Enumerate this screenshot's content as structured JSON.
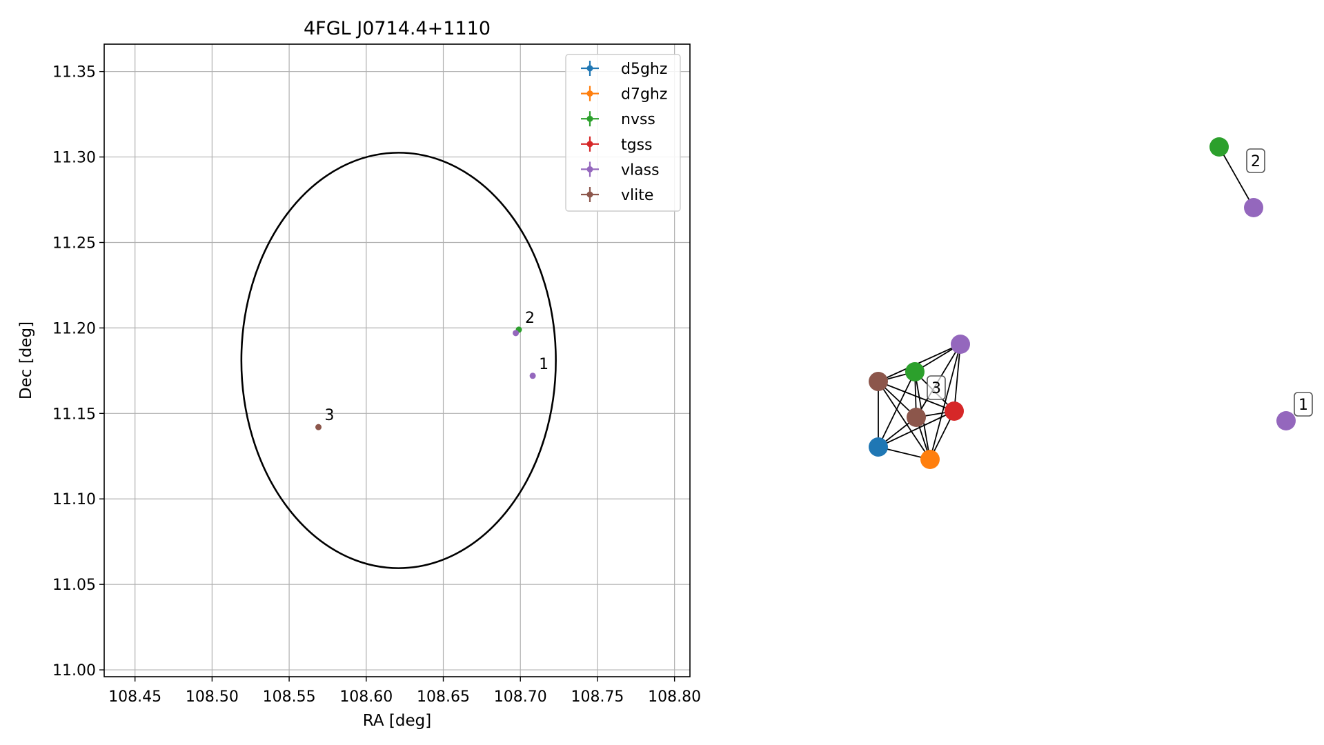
{
  "chart_data": [
    {
      "type": "scatter",
      "title": "4FGL J0714.4+1110",
      "xlabel": "RA [deg]",
      "ylabel": "Dec [deg]",
      "xlim": [
        108.43,
        108.81
      ],
      "ylim": [
        10.996,
        11.366
      ],
      "x_ticks": [
        108.45,
        108.5,
        108.55,
        108.6,
        108.65,
        108.7,
        108.75,
        108.8
      ],
      "x_tick_labels": [
        "108.45",
        "108.50",
        "108.55",
        "108.60",
        "108.65",
        "108.70",
        "108.75",
        "108.80"
      ],
      "y_ticks": [
        11.0,
        11.05,
        11.1,
        11.15,
        11.2,
        11.25,
        11.3,
        11.35
      ],
      "y_tick_labels": [
        "11.00",
        "11.05",
        "11.10",
        "11.15",
        "11.20",
        "11.25",
        "11.30",
        "11.35"
      ],
      "grid": true,
      "legend_position": "top-right",
      "ellipse": {
        "center": [
          108.621,
          11.181
        ],
        "semi_axis_ra": 0.102,
        "semi_axis_dec": 0.1215,
        "color": "#000000"
      },
      "series": [
        {
          "name": "d5ghz",
          "color": "#1f77b4",
          "points": []
        },
        {
          "name": "d7ghz",
          "color": "#ff7f0e",
          "points": []
        },
        {
          "name": "nvss",
          "color": "#2ca02c",
          "points": [
            {
              "x": 108.699,
              "y": 11.199
            }
          ]
        },
        {
          "name": "tgss",
          "color": "#d62728",
          "points": []
        },
        {
          "name": "vlass",
          "color": "#9467bd",
          "points": [
            {
              "x": 108.697,
              "y": 11.197
            },
            {
              "x": 108.708,
              "y": 11.172
            }
          ]
        },
        {
          "name": "vlite",
          "color": "#8c564b",
          "points": [
            {
              "x": 108.569,
              "y": 11.142
            }
          ]
        }
      ],
      "annotations": [
        {
          "text": "1",
          "x": 108.708,
          "y": 11.172
        },
        {
          "text": "2",
          "x": 108.699,
          "y": 11.199
        },
        {
          "text": "3",
          "x": 108.569,
          "y": 11.142
        }
      ]
    }
  ],
  "graph": {
    "nodes": [
      {
        "id": "g2_nvss",
        "color": "#2ca02c"
      },
      {
        "id": "g2_vlass",
        "color": "#9467bd"
      },
      {
        "id": "g3_vlass",
        "color": "#9467bd"
      },
      {
        "id": "g3_nvss",
        "color": "#2ca02c"
      },
      {
        "id": "g3_vlite_a",
        "color": "#8c564b"
      },
      {
        "id": "g3_vlite_b",
        "color": "#8c564b"
      },
      {
        "id": "g3_tgss",
        "color": "#d62728"
      },
      {
        "id": "g3_d5ghz",
        "color": "#1f77b4"
      },
      {
        "id": "g3_d7ghz",
        "color": "#ff7f0e"
      },
      {
        "id": "g1_vlass",
        "color": "#9467bd"
      }
    ],
    "edges": [
      [
        "g2_nvss",
        "g2_vlass"
      ],
      [
        "g3_vlass",
        "g3_nvss"
      ],
      [
        "g3_vlass",
        "g3_vlite_a"
      ],
      [
        "g3_vlass",
        "g3_vlite_b"
      ],
      [
        "g3_vlass",
        "g3_tgss"
      ],
      [
        "g3_vlass",
        "g3_d7ghz"
      ],
      [
        "g3_nvss",
        "g3_vlite_a"
      ],
      [
        "g3_nvss",
        "g3_vlite_b"
      ],
      [
        "g3_nvss",
        "g3_tgss"
      ],
      [
        "g3_nvss",
        "g3_d5ghz"
      ],
      [
        "g3_nvss",
        "g3_d7ghz"
      ],
      [
        "g3_vlite_a",
        "g3_vlite_b"
      ],
      [
        "g3_vlite_a",
        "g3_tgss"
      ],
      [
        "g3_vlite_a",
        "g3_d5ghz"
      ],
      [
        "g3_vlite_a",
        "g3_d7ghz"
      ],
      [
        "g3_vlite_b",
        "g3_tgss"
      ],
      [
        "g3_vlite_b",
        "g3_d5ghz"
      ],
      [
        "g3_vlite_b",
        "g3_d7ghz"
      ],
      [
        "g3_tgss",
        "g3_d5ghz"
      ],
      [
        "g3_tgss",
        "g3_d7ghz"
      ],
      [
        "g3_d5ghz",
        "g3_d7ghz"
      ]
    ],
    "labels": [
      {
        "text": "2",
        "near": "g2_vlass"
      },
      {
        "text": "3",
        "near": "g3_nvss"
      },
      {
        "text": "1",
        "near": "g1_vlass"
      }
    ]
  }
}
